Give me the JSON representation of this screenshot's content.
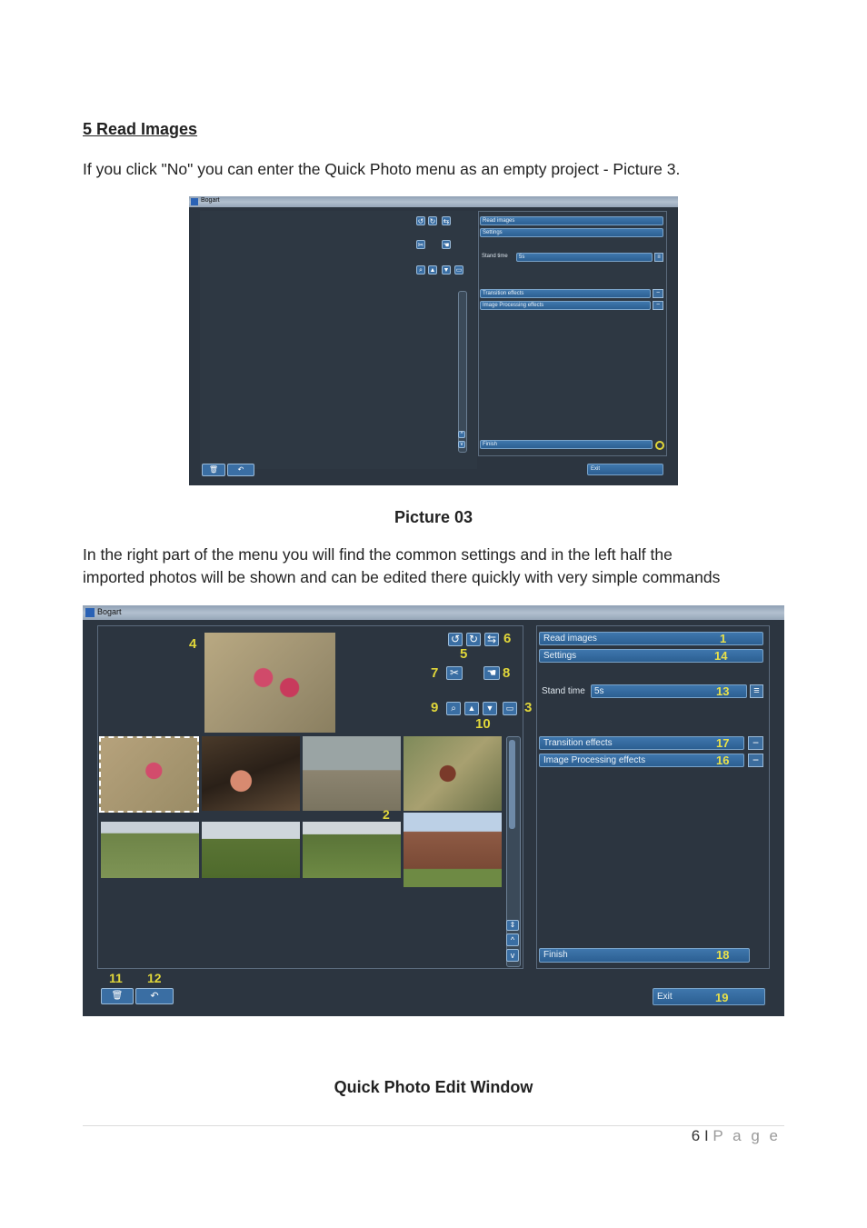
{
  "doc": {
    "heading": "5 Read Images",
    "para1": "If you click \"No\" you can enter the Quick Photo menu as an empty project - Picture 3.",
    "caption1": "Picture 03",
    "para2_line1": "In the right part of the menu you will find the common settings and in the left half the",
    "para2_line2": "imported photos will be shown and can be edited there quickly with very simple commands",
    "caption2": "Quick Photo Edit Window",
    "footer_page": "6",
    "footer_sep": "I",
    "footer_label": "P a g e"
  },
  "app1": {
    "title": "Bogart",
    "read_images": "Read images",
    "settings": "Settings",
    "stand_time_label": "Stand time",
    "stand_time_value": "5s",
    "transition_effects": "Transition effects",
    "image_processing_effects": "Image Processing effects",
    "finish": "Finish",
    "exit": "Exit"
  },
  "app2": {
    "title": "Bogart",
    "read_images": "Read images",
    "settings": "Settings",
    "stand_time_label": "Stand time",
    "stand_time_value": "5s",
    "transition_effects": "Transition effects",
    "image_processing_effects": "Image Processing effects",
    "finish": "Finish",
    "exit": "Exit",
    "callouts": {
      "n1": "1",
      "n2": "2",
      "n3": "3",
      "n4": "4",
      "n5": "5",
      "n6": "6",
      "n7": "7",
      "n8": "8",
      "n9": "9",
      "n10": "10",
      "n11": "11",
      "n12": "12",
      "n13": "13",
      "n14": "14",
      "n16": "16",
      "n17": "17",
      "n18": "18",
      "n19": "19"
    },
    "icons": [
      "rotate-left-icon",
      "rotate-right-icon",
      "flip-icon",
      "crop-icon",
      "hand-icon",
      "zoom-icon",
      "thumbs-up-icon",
      "thumbs-down-icon",
      "screen-icon",
      "trash-icon",
      "undo-icon",
      "menu-lines-icon",
      "minus-icon",
      "finish-circle-icon"
    ]
  },
  "colors": {
    "button_blue": "#3f77ad",
    "callout_yellow": "#e0d63a",
    "window_bg": "#2c3540"
  }
}
